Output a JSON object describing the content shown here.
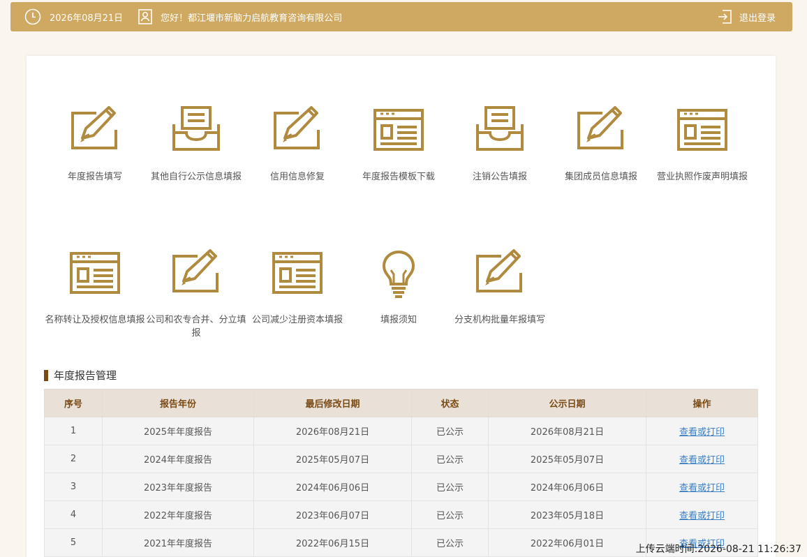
{
  "header": {
    "date": "2026年08月21日",
    "greeting": "您好！都江堰市新脑力启航教育咨询有限公司",
    "logout_label": "退出登录"
  },
  "colors": {
    "accent": "#b08a3e",
    "topbar": "#cfa961",
    "heading_bar": "#7a4a14",
    "link": "#3b7fc4"
  },
  "tiles": [
    {
      "label": "年度报告填写",
      "icon": "edit-icon"
    },
    {
      "label": "其他自行公示信息填报",
      "icon": "inbox-icon"
    },
    {
      "label": "信用信息修复",
      "icon": "edit-icon"
    },
    {
      "label": "年度报告模板下载",
      "icon": "form-icon"
    },
    {
      "label": "注销公告填报",
      "icon": "inbox-icon"
    },
    {
      "label": "集团成员信息填报",
      "icon": "edit-icon"
    },
    {
      "label": "营业执照作废声明填报",
      "icon": "form-icon"
    },
    {
      "label": "名称转让及授权信息填报",
      "icon": "form-icon"
    },
    {
      "label": "公司和农专合并、分立填报",
      "icon": "edit-icon"
    },
    {
      "label": "公司减少注册资本填报",
      "icon": "form-icon"
    },
    {
      "label": "填报须知",
      "icon": "lightbulb-icon"
    },
    {
      "label": "分支机构批量年报填写",
      "icon": "edit-icon"
    }
  ],
  "section_title": "年度报告管理",
  "table": {
    "headers": [
      "序号",
      "报告年份",
      "最后修改日期",
      "状态",
      "公示日期",
      "操作"
    ],
    "rows": [
      [
        "1",
        "2025年年度报告",
        "2026年08月21日",
        "已公示",
        "2026年08月21日",
        "查看或打印"
      ],
      [
        "2",
        "2024年年度报告",
        "2025年05月07日",
        "已公示",
        "2025年05月07日",
        "查看或打印"
      ],
      [
        "3",
        "2023年年度报告",
        "2024年06月06日",
        "已公示",
        "2024年06月06日",
        "查看或打印"
      ],
      [
        "4",
        "2022年年度报告",
        "2023年06月07日",
        "已公示",
        "2023年05月18日",
        "查看或打印"
      ],
      [
        "5",
        "2021年年度报告",
        "2022年06月15日",
        "已公示",
        "2022年06月01日",
        "查看或打印"
      ]
    ]
  },
  "upload_time": "上传云端时间:2026-08-21 11:26:37"
}
